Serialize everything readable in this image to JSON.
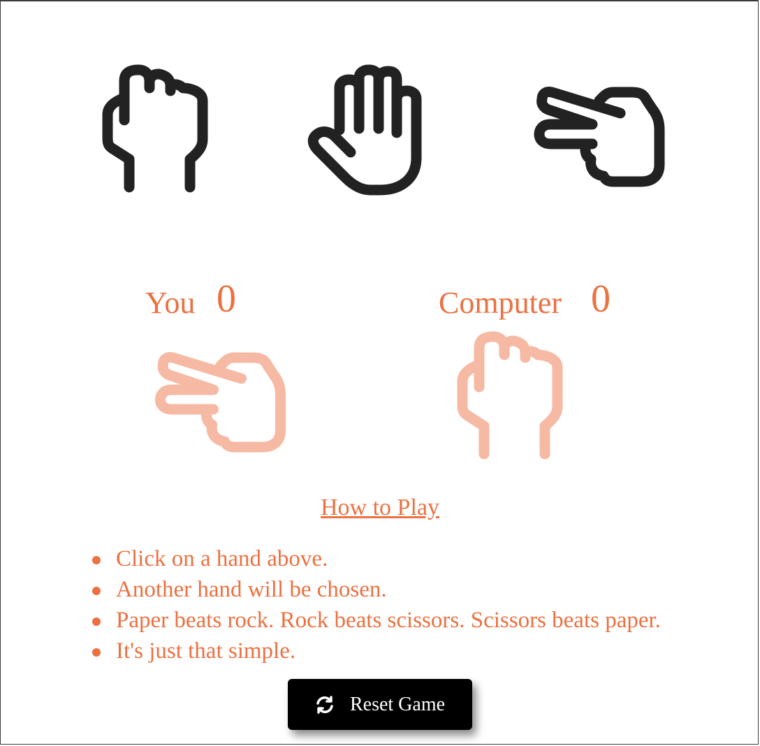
{
  "choices": [
    {
      "name": "rock",
      "icon": "rock-hand-icon"
    },
    {
      "name": "paper",
      "icon": "paper-hand-icon"
    },
    {
      "name": "scissors",
      "icon": "scissors-hand-icon"
    }
  ],
  "score": {
    "you_label": "You",
    "you_value": "0",
    "computer_label": "Computer",
    "computer_value": "0"
  },
  "shown_hands": {
    "you": "scissors-hand-icon",
    "computer": "rock-hand-icon"
  },
  "how_to": {
    "title": "How to Play",
    "rules": [
      "Click on a hand above.",
      "Another hand will be chosen.",
      "Paper beats rock. Rock beats scissors. Scissors beats paper.",
      "It's just that simple."
    ]
  },
  "reset_button": {
    "label": "Reset Game",
    "icon": "refresh-icon"
  },
  "colors": {
    "accent": "#ec7040",
    "shown_hand": "#f6b9a3",
    "icon_dark": "#222222"
  }
}
